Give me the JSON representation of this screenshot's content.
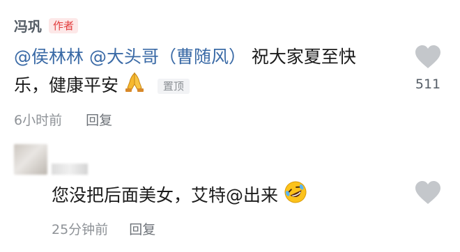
{
  "comments": [
    {
      "author": "冯巩",
      "badge": "作者",
      "mention1": "@侯林林",
      "mention2": "@大头哥（曹随风）",
      "text_line1_rest": " 祝大家夏至快",
      "text_line2": "乐，健康平安",
      "emoji": "praying-hands",
      "pinned_label": "置顶",
      "time": "6小时前",
      "reply_label": "回复",
      "like_count": "511"
    },
    {
      "text": "您没把后面美女，艾特@出来",
      "emoji": "rolling-laughing-face",
      "time": "25分钟前",
      "reply_label": "回复"
    }
  ],
  "colors": {
    "mention": "#3a6aa6",
    "badge_text": "#e23d3d",
    "badge_bg": "#fde8e8",
    "heart": "#c4c7cb",
    "meta": "#8e9297"
  }
}
